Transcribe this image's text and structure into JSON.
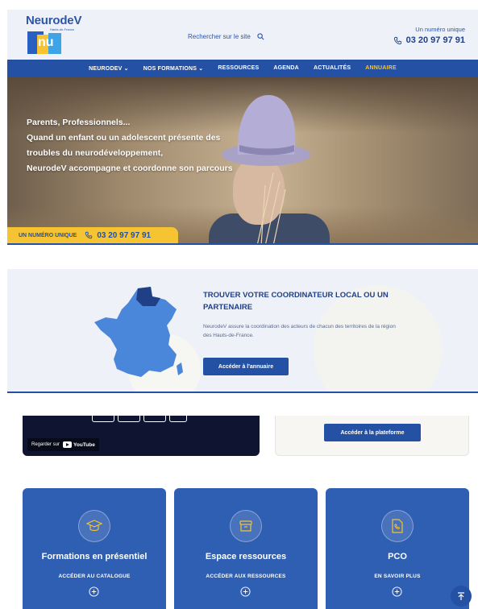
{
  "header": {
    "logo_text": "NeurodeV",
    "logo_sub": "Hauts-de-France",
    "logo_mark": "nu",
    "search_label": "Rechercher sur le site",
    "phone_label": "Un numéro unique",
    "phone_number": "03 20 97 97 91"
  },
  "nav": {
    "items": [
      {
        "label": "NEURODEV",
        "dropdown": true
      },
      {
        "label": "NOS FORMATIONS",
        "dropdown": true
      },
      {
        "label": "RESSOURCES"
      },
      {
        "label": "AGENDA"
      },
      {
        "label": "ACTUALITÉS"
      },
      {
        "label": "ANNUAIRE",
        "active": true
      }
    ],
    "chevron": "⌄"
  },
  "hero": {
    "lines": [
      "Parents, Professionnels...",
      "Quand un enfant ou un adolescent présente des troubles du neurodéveloppement,",
      "NeurodeV accompagne et coordonne son parcours"
    ],
    "phone_label": "UN NUMÉRO UNIQUE",
    "phone_number": "03 20 97 97 91"
  },
  "coordinator": {
    "title": "TROUVER VOTRE COORDINATEUR LOCAL OU UN PARTENAIRE",
    "description": "NeurodeV assure la coordination des acteurs de chacun des territoires de la région des Hauts-de-France.",
    "button": "Accéder à l'annuaire"
  },
  "video": {
    "watch_on": "Regarder sur",
    "youtube": "YouTube"
  },
  "platform": {
    "button": "Accéder à la plateforme"
  },
  "cards": [
    {
      "title": "Formations en présentiel",
      "cta": "ACCÉDER AU CATALOGUE",
      "icon": "graduation-cap-icon"
    },
    {
      "title": "Espace ressources",
      "cta": "ACCÉDER AUX RESSOURCES",
      "icon": "archive-box-icon"
    },
    {
      "title": "PCO",
      "cta": "EN SAVOIR PLUS",
      "icon": "phone-document-icon"
    }
  ],
  "colors": {
    "primary": "#2451a3",
    "accent": "#f6c332",
    "card_bg": "#2f5fb3",
    "header_bg": "#eef1f8"
  }
}
